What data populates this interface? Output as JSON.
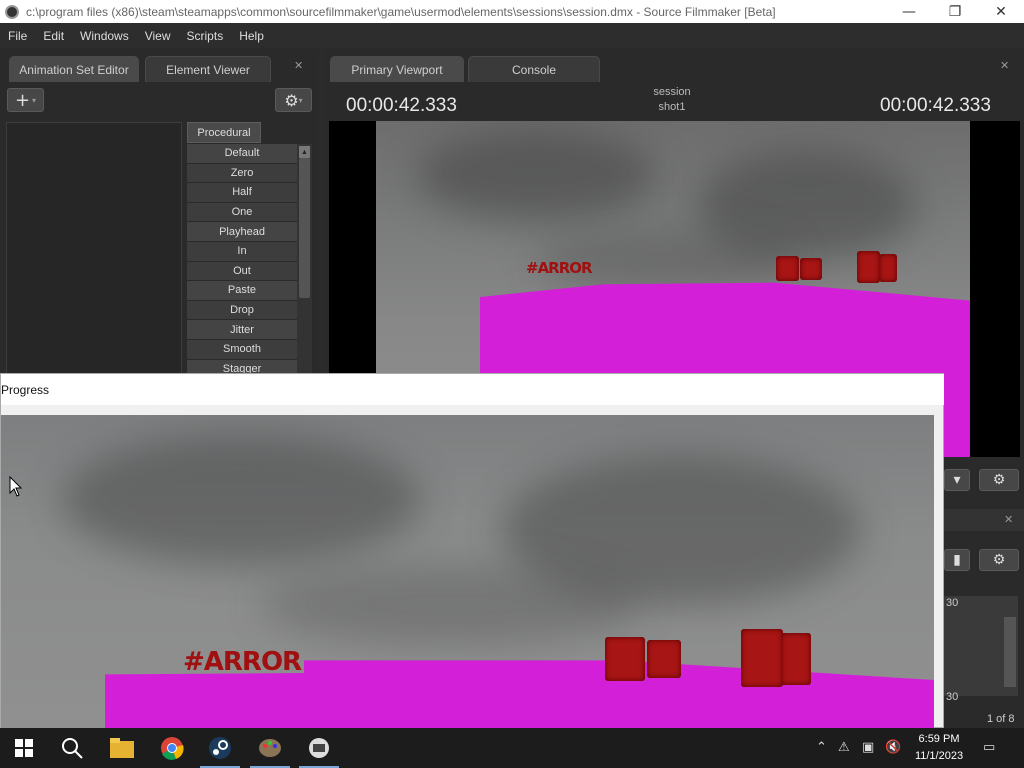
{
  "window": {
    "title": "c:\\program files (x86)\\steam\\steamapps\\common\\sourcefilmmaker\\game\\usermod\\elements\\sessions\\session.dmx - Source Filmmaker [Beta]",
    "minimize_icon": "minimize-icon",
    "maximize_icon": "restore-icon",
    "close_icon": "close-icon"
  },
  "menu": [
    "File",
    "Edit",
    "Windows",
    "View",
    "Scripts",
    "Help"
  ],
  "left_panel": {
    "tabs": [
      "Animation Set Editor",
      "Element Viewer"
    ],
    "add_label": "+",
    "procedural_tab": "Procedural",
    "procedural_items": [
      "Default",
      "Zero",
      "Half",
      "One",
      "Playhead",
      "In",
      "Out",
      "Paste",
      "Drop",
      "Jitter",
      "Smooth",
      "Stagger"
    ]
  },
  "right_panel": {
    "tabs": [
      "Primary Viewport",
      "Console"
    ],
    "timecode_left": "00:00:42.333",
    "timecode_right": "00:00:42.333",
    "session_name": "session",
    "shot_name": "shot1"
  },
  "dialog": {
    "title": "Progress"
  },
  "right_strip": {
    "ruler_mark": "30",
    "ruler_mark_2": "30",
    "page_count": "1 of 8"
  },
  "taskbar": {
    "time": "6:59 PM",
    "date": "11/1/2023"
  },
  "colors": {
    "magenta": "#d41fd8",
    "panel_bg": "#2a2a2a",
    "taskbar_bg": "#1c1c1c"
  }
}
